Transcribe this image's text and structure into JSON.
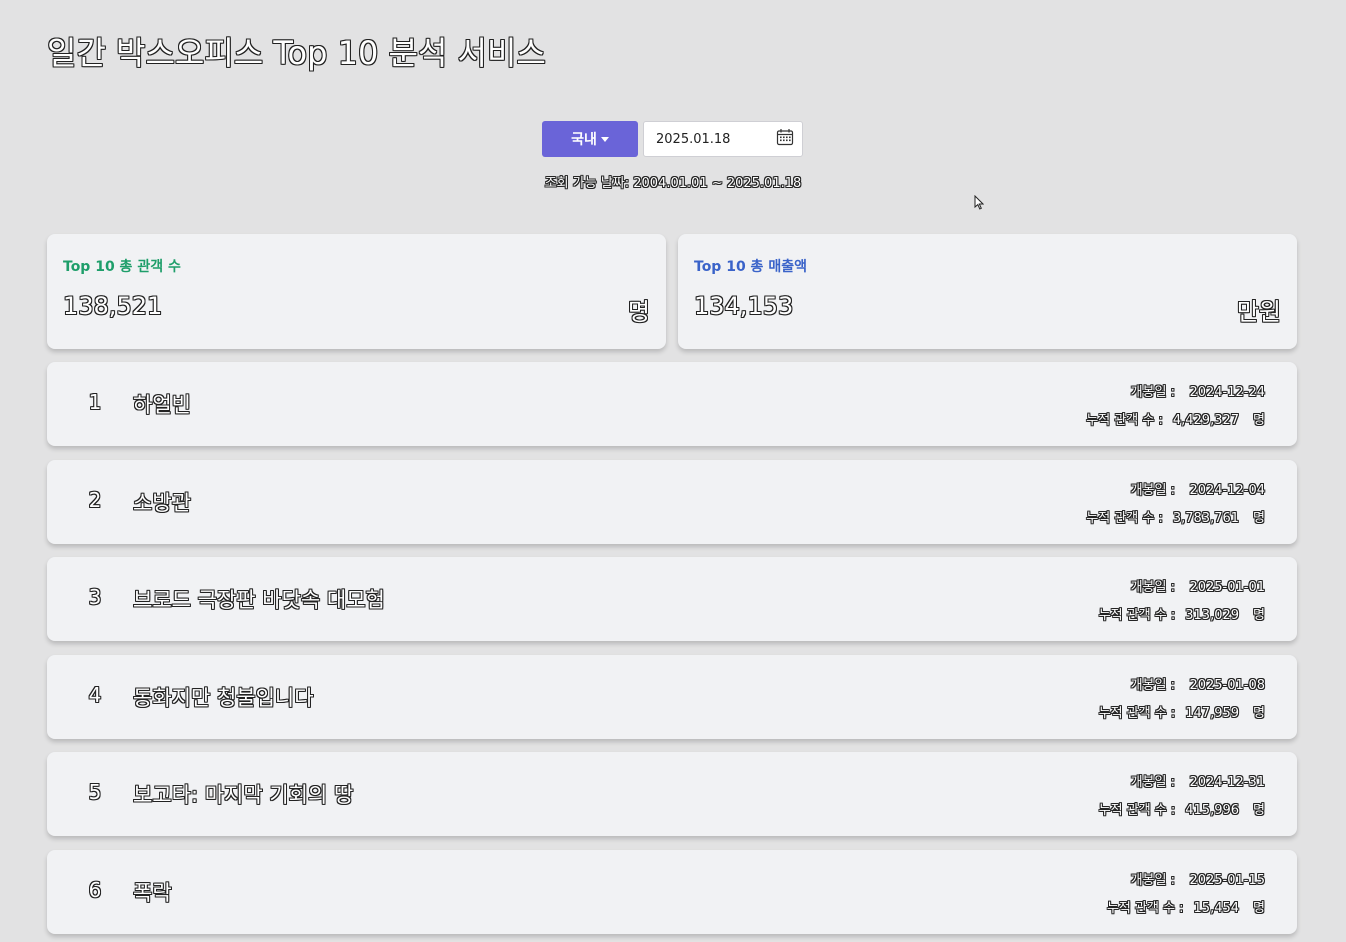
{
  "page": {
    "title": "일간 박스오피스 Top 10 분석 서비스"
  },
  "controls": {
    "region_label": "국내",
    "date_value": "2025.01.18",
    "range_text": "조회 가능 날짜: 2004.01.01 ~ 2025.01.18"
  },
  "stats": {
    "audience": {
      "label": "Top 10 총 관객 수",
      "value": "138,521",
      "unit": "명",
      "color": "#1e9e6a"
    },
    "sales": {
      "label": "Top 10 총 매출액",
      "value": "134,153",
      "unit": "만원",
      "color": "#3a63c9"
    }
  },
  "labels": {
    "release": "개봉일 :",
    "cumulative": "누적 관객 수 :",
    "person_unit": "명"
  },
  "movies": [
    {
      "rank": "1",
      "title": "하얼빈",
      "release_date": "2024-12-24",
      "audience": "4,429,327"
    },
    {
      "rank": "2",
      "title": "소방관",
      "release_date": "2024-12-04",
      "audience": "3,783,761"
    },
    {
      "rank": "3",
      "title": "브로드 극장판 바닷속 대모험",
      "release_date": "2025-01-01",
      "audience": "313,029"
    },
    {
      "rank": "4",
      "title": "동화지만 청불입니다",
      "release_date": "2025-01-08",
      "audience": "147,959"
    },
    {
      "rank": "5",
      "title": "보고타: 마지막 기회의 땅",
      "release_date": "2024-12-31",
      "audience": "415,996"
    },
    {
      "rank": "6",
      "title": "폭락",
      "release_date": "2025-01-15",
      "audience": "15,454"
    }
  ],
  "colors": {
    "accent": "#6a64d8",
    "background": "#e2e2e3",
    "card": "#f1f2f4"
  }
}
